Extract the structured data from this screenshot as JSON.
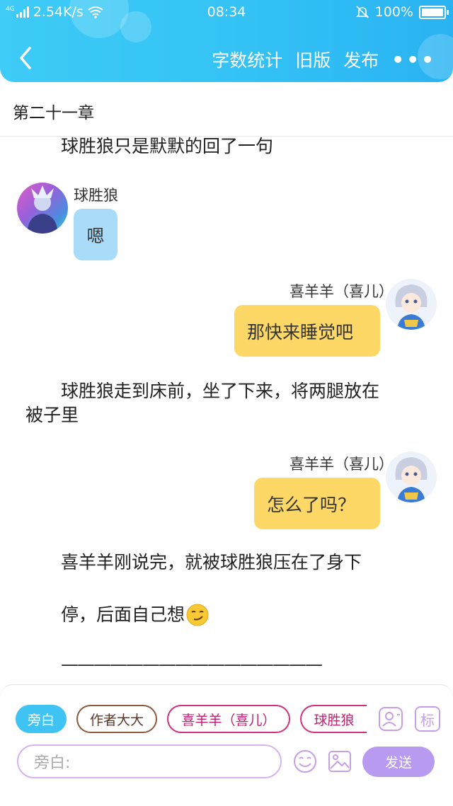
{
  "status_bar": {
    "network": "4G",
    "speed": "2.54K/s",
    "time": "08:34",
    "battery": "100%"
  },
  "nav": {
    "actions": [
      {
        "label": "字数统计"
      },
      {
        "label": "旧版"
      },
      {
        "label": "发布"
      }
    ],
    "more_label": "•••"
  },
  "chapter": {
    "title": "第二十一章"
  },
  "story": {
    "narration_1": "球胜狼只是默默的回了一句",
    "msg_1": {
      "name": "球胜狼",
      "text": "嗯"
    },
    "msg_2": {
      "name": "喜羊羊（喜儿）",
      "text": "那快来睡觉吧"
    },
    "narration_2_line1": "球胜狼走到床前，坐了下来，将两腿放在",
    "narration_2_line2": "被子里",
    "msg_3": {
      "name": "喜羊羊（喜儿）",
      "text": "怎么了吗？"
    },
    "narration_3": "喜羊羊刚说完，就被球胜狼压在了身下",
    "narration_4": "停，后面自己想",
    "divider": "————————————————"
  },
  "composer": {
    "roles": [
      {
        "label": "旁白"
      },
      {
        "label": "作者大大"
      },
      {
        "label": "喜羊羊（喜儿）"
      },
      {
        "label": "球胜狼"
      }
    ],
    "tag_label": "标",
    "input_placeholder": "旁白:",
    "send_label": "发送"
  },
  "colors": {
    "header": "#35c3f5",
    "bubble_left": "#a9dcf8",
    "bubble_right": "#fdd866",
    "accent_purple": "#b89af0",
    "role_active": "#3ec3f3",
    "role_author": "#8b5a3c",
    "role_pink": "#d0307f"
  },
  "icons": [
    "signal-icon",
    "wifi-icon",
    "mute-icon",
    "battery-icon",
    "back-icon",
    "more-icon",
    "role-manage-icon",
    "tag-icon",
    "emoji-icon",
    "image-icon"
  ]
}
